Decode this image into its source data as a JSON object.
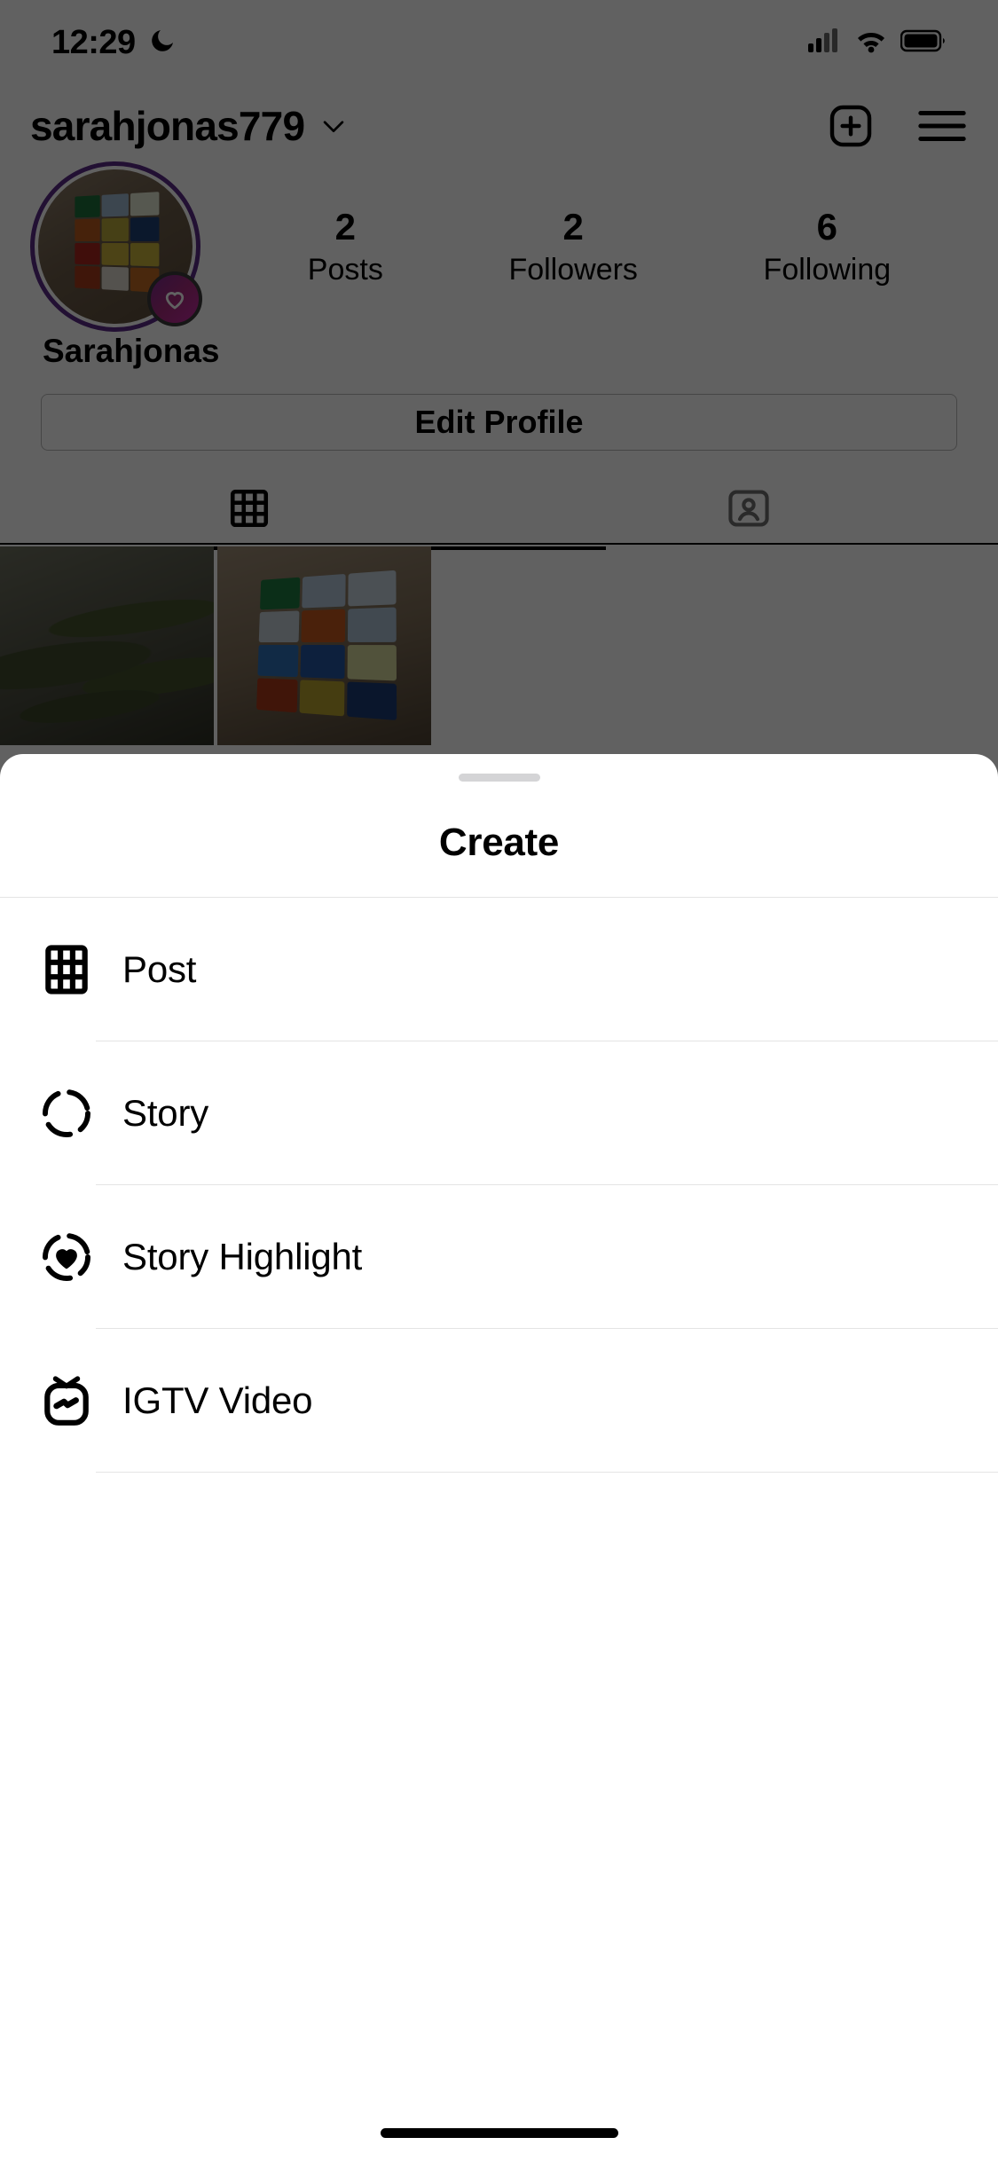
{
  "status_bar": {
    "time": "12:29",
    "icons": [
      "moon-icon",
      "cellular-signal-icon",
      "wifi-icon",
      "battery-icon"
    ]
  },
  "profile": {
    "username": "sarahjonas779",
    "username_chevron": "chevron-down-icon",
    "header_icons": [
      "add-post-icon",
      "hamburger-menu-icon"
    ],
    "full_name": "Sarahjonas",
    "edit_profile_label": "Edit Profile",
    "avatar_badge": "heart-badge-icon",
    "stats": [
      {
        "value": "2",
        "label": "Posts"
      },
      {
        "value": "2",
        "label": "Followers"
      },
      {
        "value": "6",
        "label": "Following"
      }
    ],
    "tabs": [
      {
        "icon": "grid-icon",
        "active": true
      },
      {
        "icon": "tagged-person-icon",
        "active": false
      }
    ]
  },
  "create_sheet": {
    "title": "Create",
    "grabber": "drag-handle",
    "items": [
      {
        "icon": "grid-icon",
        "label": "Post"
      },
      {
        "icon": "story-circle-icon",
        "label": "Story"
      },
      {
        "icon": "story-highlight-heart-icon",
        "label": "Story Highlight"
      },
      {
        "icon": "igtv-icon",
        "label": "IGTV Video"
      }
    ]
  },
  "colors": {
    "story_ring": "#5b2a86",
    "badge_gradient_start": "#7b2d8e",
    "badge_gradient_end": "#c32aa3",
    "sheet_background": "#ffffff",
    "scrim": "rgba(0,0,0,0.62)"
  }
}
